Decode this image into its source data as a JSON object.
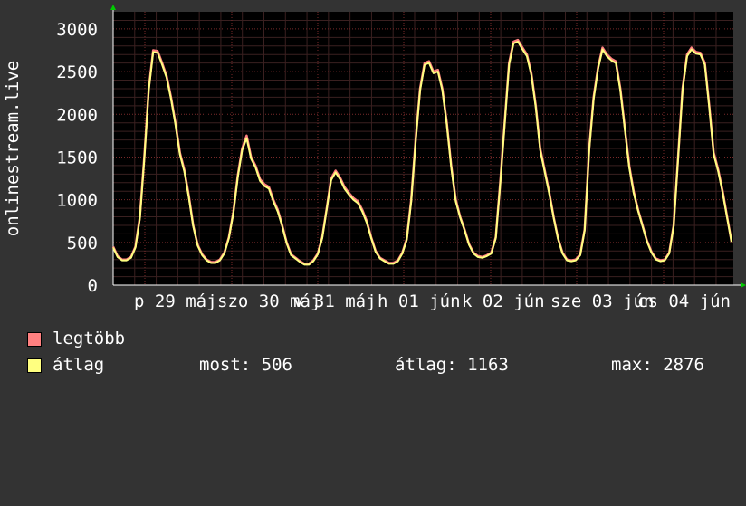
{
  "chart_data": {
    "type": "line",
    "ylabel": "onlinestream.live",
    "ylim": [
      0,
      3200
    ],
    "yticks": [
      0,
      500,
      1000,
      1500,
      2000,
      2500,
      3000
    ],
    "xticks": [
      "p 29 máj",
      "szo 30 máj",
      "v 31 máj",
      "h 01 jún",
      "k 02 jún",
      "sze 03 jún",
      "cs 04 jún"
    ],
    "grid": true,
    "legend_position": "bottom",
    "series": [
      {
        "name": "legtöbb",
        "color": "#ff8080",
        "values": [
          450,
          340,
          300,
          300,
          330,
          450,
          800,
          1500,
          2300,
          2750,
          2740,
          2600,
          2450,
          2200,
          1900,
          1550,
          1350,
          1050,
          700,
          470,
          360,
          300,
          270,
          270,
          300,
          380,
          560,
          850,
          1280,
          1600,
          1750,
          1500,
          1400,
          1240,
          1180,
          1150,
          1000,
          880,
          700,
          500,
          360,
          320,
          280,
          250,
          250,
          290,
          370,
          560,
          900,
          1250,
          1340,
          1260,
          1150,
          1080,
          1020,
          980,
          880,
          750,
          560,
          400,
          320,
          290,
          260,
          260,
          290,
          380,
          540,
          1000,
          1700,
          2300,
          2600,
          2620,
          2500,
          2520,
          2300,
          1900,
          1400,
          1000,
          800,
          650,
          480,
          380,
          340,
          330,
          350,
          380,
          560,
          1200,
          1900,
          2600,
          2850,
          2870,
          2780,
          2700,
          2480,
          2100,
          1600,
          1350,
          1100,
          800,
          550,
          380,
          300,
          290,
          300,
          360,
          650,
          1600,
          2200,
          2550,
          2780,
          2700,
          2650,
          2620,
          2300,
          1850,
          1400,
          1100,
          880,
          700,
          520,
          390,
          310,
          290,
          300,
          380,
          700,
          1500,
          2300,
          2700,
          2780,
          2730,
          2720,
          2600,
          2100,
          1550,
          1350,
          1100,
          800,
          510
        ]
      },
      {
        "name": "átlag",
        "color": "#ffff80",
        "values": [
          440,
          330,
          290,
          290,
          320,
          440,
          780,
          1480,
          2280,
          2730,
          2720,
          2580,
          2430,
          2180,
          1880,
          1530,
          1330,
          1030,
          690,
          460,
          350,
          290,
          260,
          260,
          290,
          370,
          550,
          840,
          1260,
          1580,
          1720,
          1480,
          1380,
          1220,
          1160,
          1130,
          980,
          860,
          690,
          490,
          350,
          310,
          270,
          240,
          240,
          280,
          360,
          550,
          890,
          1230,
          1320,
          1240,
          1130,
          1060,
          1000,
          960,
          860,
          730,
          550,
          390,
          310,
          280,
          250,
          250,
          280,
          370,
          530,
          980,
          1680,
          2280,
          2580,
          2600,
          2480,
          2500,
          2280,
          1880,
          1380,
          980,
          790,
          640,
          470,
          370,
          330,
          320,
          340,
          370,
          550,
          1180,
          1880,
          2580,
          2830,
          2850,
          2760,
          2680,
          2460,
          2080,
          1580,
          1330,
          1080,
          790,
          540,
          370,
          290,
          280,
          290,
          350,
          640,
          1580,
          2180,
          2530,
          2760,
          2680,
          2630,
          2600,
          2280,
          1830,
          1380,
          1080,
          870,
          690,
          510,
          380,
          300,
          280,
          290,
          370,
          690,
          1480,
          2280,
          2680,
          2760,
          2710,
          2700,
          2580,
          2080,
          1530,
          1330,
          1080,
          790,
          506
        ]
      }
    ]
  },
  "legend": {
    "items": [
      {
        "label": "legtöbb",
        "color": "#ff8080"
      },
      {
        "label": "átlag",
        "color": "#ffff80"
      }
    ]
  },
  "stats": {
    "most": "most: 506",
    "atlag": "átlag: 1163",
    "max": "max: 2876"
  }
}
